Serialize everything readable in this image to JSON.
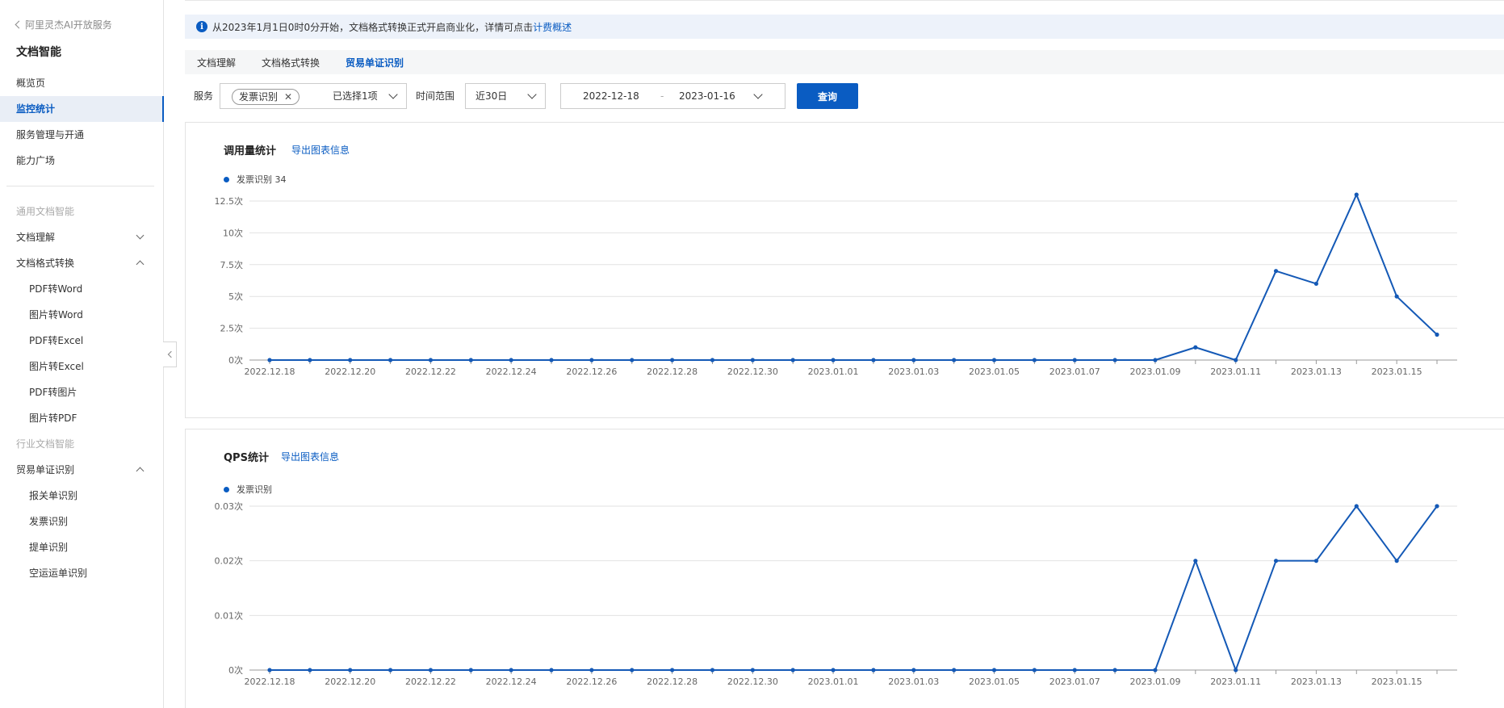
{
  "sidebar": {
    "back_label": "阿里灵杰AI开放服务",
    "title": "文档智能",
    "nav": [
      "概览页",
      "监控统计",
      "服务管理与开通",
      "能力广场"
    ],
    "active_nav": "监控统计",
    "group_general": "通用文档智能",
    "doc_understand": "文档理解",
    "doc_convert": "文档格式转换",
    "convert_items": [
      "PDF转Word",
      "图片转Word",
      "PDF转Excel",
      "图片转Excel",
      "PDF转图片",
      "图片转PDF"
    ],
    "group_industry": "行业文档智能",
    "trade": "贸易单证识别",
    "trade_items": [
      "报关单识别",
      "发票识别",
      "提单识别",
      "空运运单识别"
    ]
  },
  "notice": {
    "text": "从2023年1月1日0时0分开始，文档格式转换正式开启商业化，详情可点击",
    "link": "计费概述"
  },
  "tabs": [
    "文档理解",
    "文档格式转换",
    "贸易单证识别"
  ],
  "active_tab": "贸易单证识别",
  "filters": {
    "service_label": "服务",
    "service_tag": "发票识别",
    "service_summary": "已选择1项",
    "range_label": "时间范围",
    "range_value": "近30日",
    "date_start": "2022-12-18",
    "date_sep": "-",
    "date_end": "2023-01-16",
    "query_label": "查询"
  },
  "colors": {
    "accent": "#0a5cc2",
    "series": "#1459b6"
  },
  "chart_data": [
    {
      "type": "line",
      "title": "调用量统计",
      "export_label": "导出图表信息",
      "legend": "发票识别 34",
      "x": [
        "2022.12.18",
        "2022.12.19",
        "2022.12.20",
        "2022.12.21",
        "2022.12.22",
        "2022.12.23",
        "2022.12.24",
        "2022.12.25",
        "2022.12.26",
        "2022.12.27",
        "2022.12.28",
        "2022.12.29",
        "2022.12.30",
        "2022.12.31",
        "2023.01.01",
        "2023.01.02",
        "2023.01.03",
        "2023.01.04",
        "2023.01.05",
        "2023.01.06",
        "2023.01.07",
        "2023.01.08",
        "2023.01.09",
        "2023.01.10",
        "2023.01.11",
        "2023.01.12",
        "2023.01.13",
        "2023.01.14",
        "2023.01.15",
        "2023.01.16"
      ],
      "series": [
        {
          "name": "发票识别",
          "values": [
            0,
            0,
            0,
            0,
            0,
            0,
            0,
            0,
            0,
            0,
            0,
            0,
            0,
            0,
            0,
            0,
            0,
            0,
            0,
            0,
            0,
            0,
            0,
            1,
            0,
            7,
            6,
            13,
            5,
            2
          ]
        }
      ],
      "ylim": [
        0,
        12.5
      ],
      "yticks": [
        "0次",
        "2.5次",
        "5次",
        "7.5次",
        "10次",
        "12.5次"
      ],
      "ytick_values": [
        0,
        2.5,
        5,
        7.5,
        10,
        12.5
      ],
      "xticks_every": 2,
      "grid": true
    },
    {
      "type": "line",
      "title": "QPS统计",
      "export_label": "导出图表信息",
      "legend": "发票识别",
      "x": [
        "2022.12.18",
        "2022.12.19",
        "2022.12.20",
        "2022.12.21",
        "2022.12.22",
        "2022.12.23",
        "2022.12.24",
        "2022.12.25",
        "2022.12.26",
        "2022.12.27",
        "2022.12.28",
        "2022.12.29",
        "2022.12.30",
        "2022.12.31",
        "2023.01.01",
        "2023.01.02",
        "2023.01.03",
        "2023.01.04",
        "2023.01.05",
        "2023.01.06",
        "2023.01.07",
        "2023.01.08",
        "2023.01.09",
        "2023.01.10",
        "2023.01.11",
        "2023.01.12",
        "2023.01.13",
        "2023.01.14",
        "2023.01.15",
        "2023.01.16"
      ],
      "series": [
        {
          "name": "发票识别",
          "values": [
            0,
            0,
            0,
            0,
            0,
            0,
            0,
            0,
            0,
            0,
            0,
            0,
            0,
            0,
            0,
            0,
            0,
            0,
            0,
            0,
            0,
            0,
            0,
            0.02,
            0,
            0.02,
            0.02,
            0.03,
            0.02,
            0.03
          ]
        }
      ],
      "ylim": [
        0,
        0.03
      ],
      "yticks": [
        "0次",
        "0.01次",
        "0.02次",
        "0.03次"
      ],
      "ytick_values": [
        0,
        0.01,
        0.02,
        0.03
      ],
      "xticks_every": 2,
      "grid": true
    }
  ]
}
